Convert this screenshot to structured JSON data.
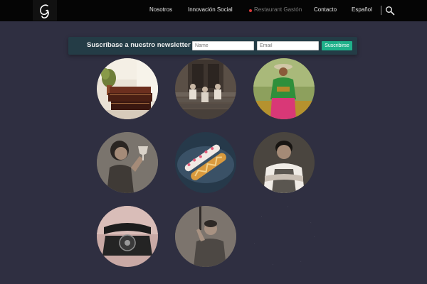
{
  "header": {
    "logo_icon": "g-script-logo-icon",
    "nav": [
      {
        "label": "Nosotros"
      },
      {
        "label": "Innovación Social"
      },
      {
        "label": "Restaurant Gastón"
      },
      {
        "label": "Contacto"
      },
      {
        "label": "Español"
      }
    ],
    "search_icon": "search-icon",
    "active_dot_color": "#d83a3a"
  },
  "newsletter": {
    "title": "Suscríbase a nuestro newsletter",
    "name_placeholder": "Name",
    "email_placeholder": "Email",
    "button_label": "Suscribirse",
    "button_color": "#1fb08a"
  },
  "gallery": {
    "items": [
      {
        "subject": "stacked-books-with-plant"
      },
      {
        "subject": "group-on-steps-sepia"
      },
      {
        "subject": "woman-in-green-with-vegetables"
      },
      {
        "subject": "woman-with-wine-glass"
      },
      {
        "subject": "pastry-plate"
      },
      {
        "subject": "chef-arms-crossed"
      },
      {
        "subject": "vintage-telephone"
      },
      {
        "subject": "man-holding-tool"
      },
      {
        "subject": "empty-placeholder"
      }
    ]
  }
}
